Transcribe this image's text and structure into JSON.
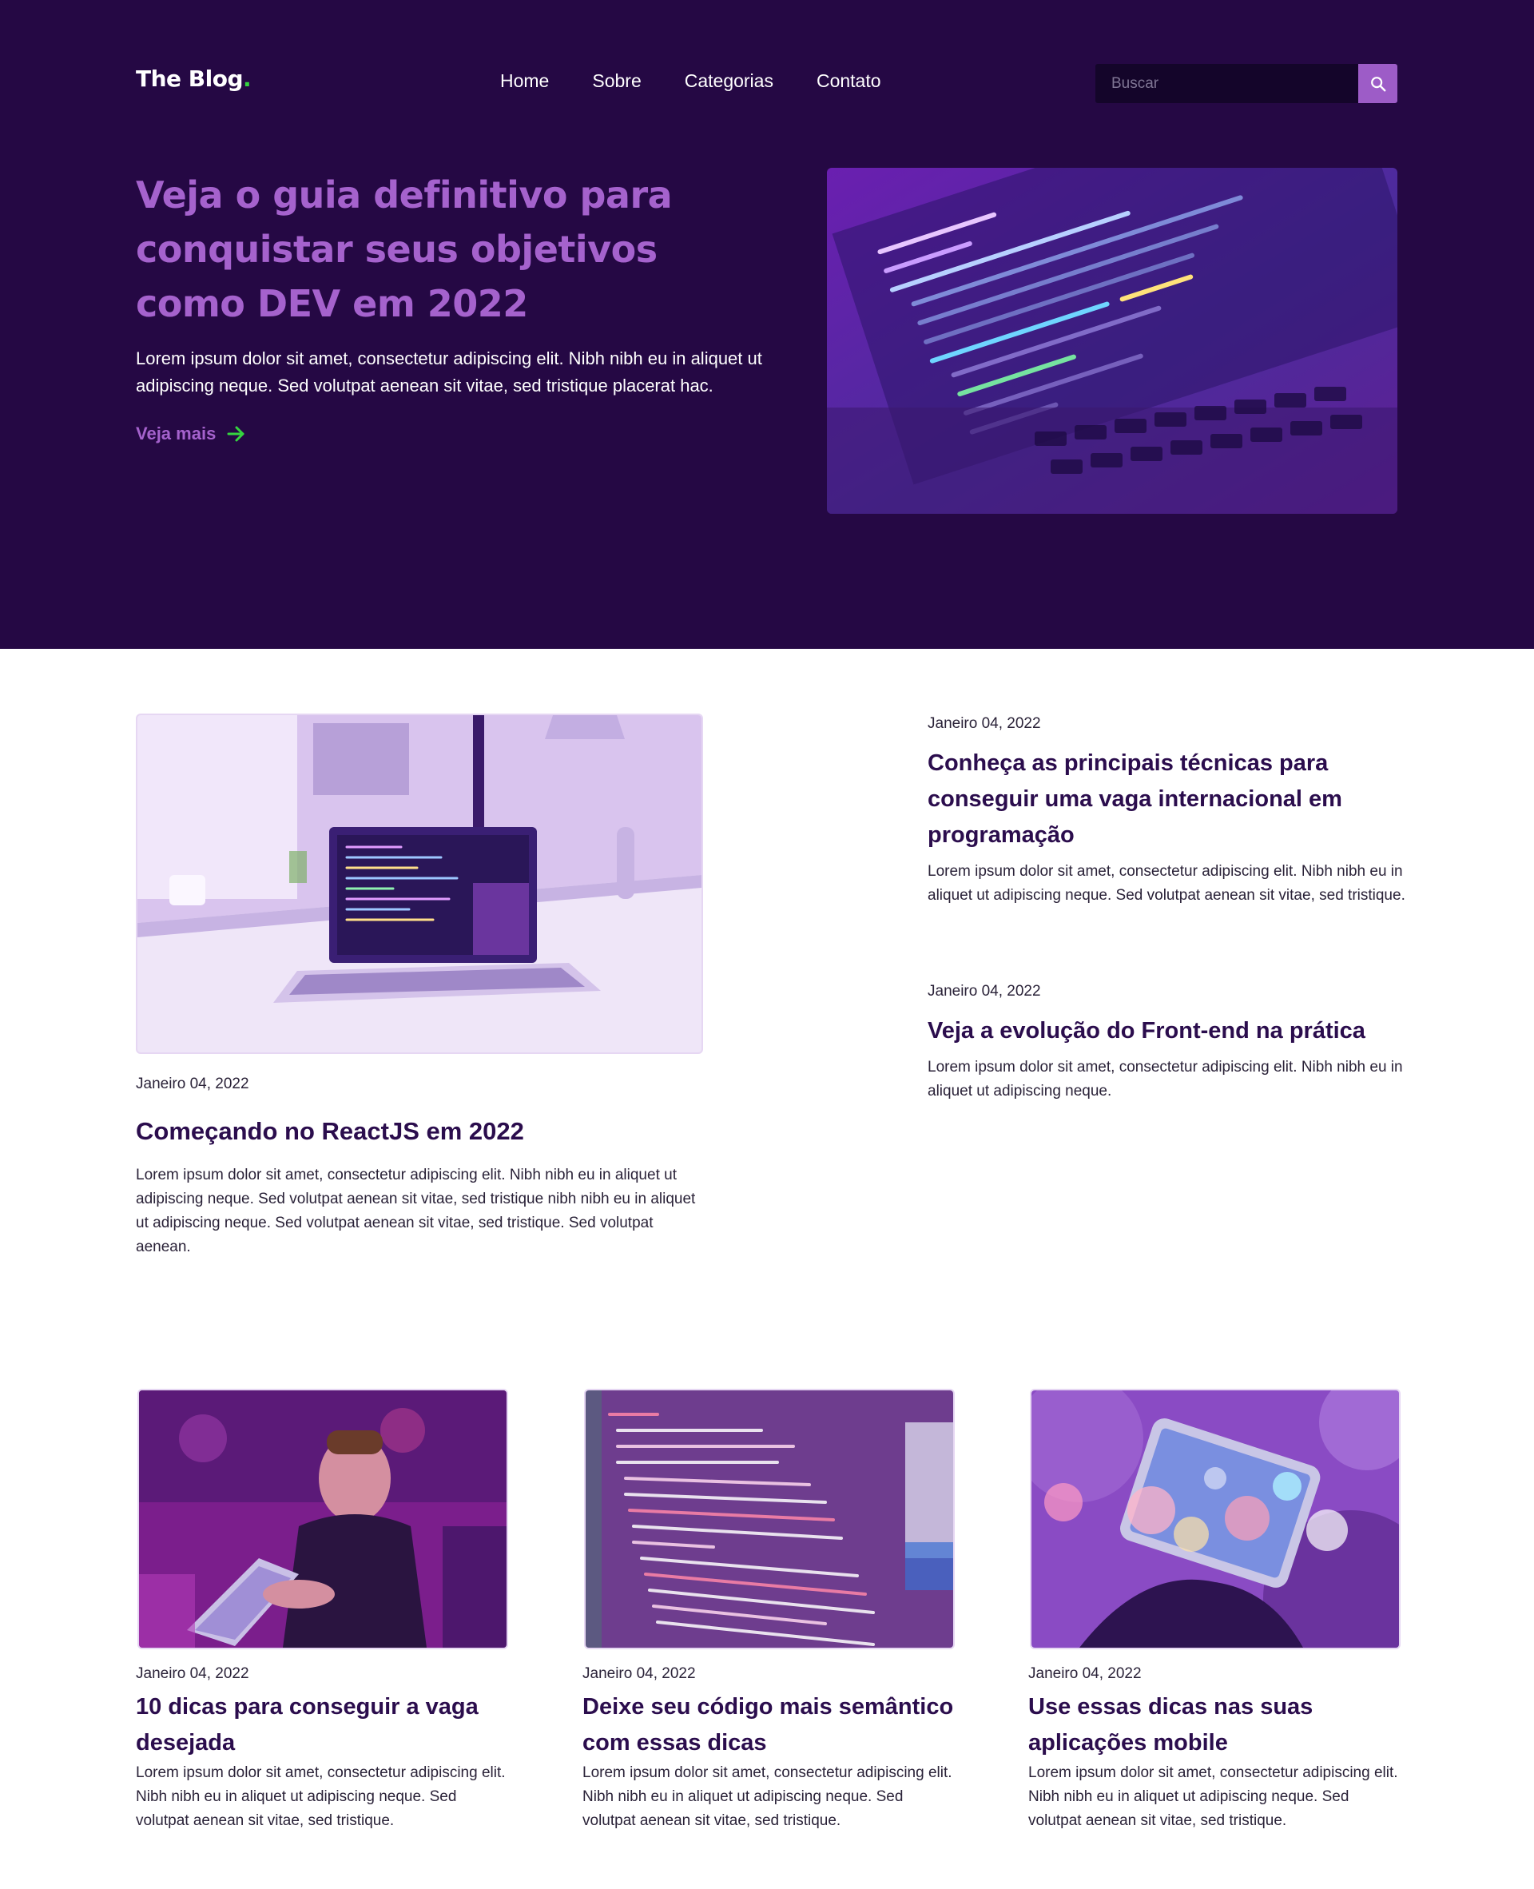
{
  "header": {
    "logo": "The Blog",
    "logo_dot": ".",
    "nav": [
      "Home",
      "Sobre",
      "Categorias",
      "Contato"
    ],
    "search_placeholder": "Buscar"
  },
  "hero": {
    "title": "Veja o guia definitivo para conquistar seus objetivos como DEV em 2022",
    "text": "Lorem ipsum dolor sit amet, consectetur adipiscing elit. Nibh nibh eu in aliquet ut adipiscing neque. Sed volutpat aenean sit vitae, sed tristique placerat hac.",
    "link": "Veja mais"
  },
  "featured": {
    "date": "Janeiro 04, 2022",
    "title": "Começando no ReactJS em 2022",
    "excerpt": "Lorem ipsum dolor sit amet, consectetur adipiscing elit. Nibh nibh eu in aliquet ut adipiscing neque. Sed volutpat aenean sit vitae, sed tristique nibh nibh eu in aliquet ut adipiscing neque. Sed volutpat aenean sit vitae, sed tristique. Sed volutpat aenean."
  },
  "side_posts": [
    {
      "date": "Janeiro 04, 2022",
      "title": "Conheça as principais técnicas para conseguir uma vaga internacional em programação",
      "excerpt": "Lorem ipsum dolor sit amet, consectetur adipiscing elit. Nibh nibh eu in aliquet ut adipiscing neque. Sed volutpat aenean sit vitae, sed tristique."
    },
    {
      "date": "Janeiro 04, 2022",
      "title": "Veja a evolução do Front-end na prática",
      "excerpt": "Lorem ipsum dolor sit amet, consectetur adipiscing elit. Nibh nibh eu in aliquet ut adipiscing neque."
    }
  ],
  "cards": [
    {
      "date": "Janeiro 04, 2022",
      "title": "10 dicas para conseguir a vaga desejada",
      "excerpt": "Lorem ipsum dolor sit amet, consectetur adipiscing elit. Nibh nibh eu in aliquet ut adipiscing neque. Sed volutpat aenean sit vitae, sed tristique."
    },
    {
      "date": "Janeiro 04, 2022",
      "title": "Deixe seu código mais semântico com essas dicas",
      "excerpt": "Lorem ipsum dolor sit amet, consectetur adipiscing elit. Nibh nibh eu in aliquet ut adipiscing neque. Sed volutpat aenean sit vitae, sed tristique."
    },
    {
      "date": "Janeiro 04, 2022",
      "title": "Use essas dicas nas suas aplicações mobile",
      "excerpt": "Lorem ipsum dolor sit amet, consectetur adipiscing elit. Nibh nibh eu in aliquet ut adipiscing neque. Sed volutpat aenean sit vitae, sed tristique."
    }
  ],
  "colors": {
    "hero_bg": "#250844",
    "accent": "#a562cd",
    "arrow": "#35d43f",
    "title_text": "#2b0d4d"
  },
  "icons": {
    "search": "search-icon",
    "arrow": "arrow-right-icon"
  }
}
